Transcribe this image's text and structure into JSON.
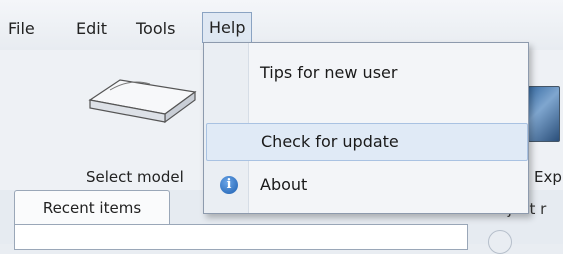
{
  "menubar": {
    "items": [
      {
        "label": "File"
      },
      {
        "label": "Edit"
      },
      {
        "label": "Tools"
      },
      {
        "label": "Help"
      }
    ]
  },
  "toolbar": {
    "select_model_label": "Select model",
    "right_label": "Exp"
  },
  "help_menu": {
    "items": [
      {
        "label": "Tips for new user"
      },
      {
        "label": "Check for update"
      },
      {
        "label": "About",
        "icon": "info-icon"
      }
    ],
    "hovered_item": "Check for update"
  },
  "tabs": {
    "recent_items_label": "Recent items",
    "side_label": "Project r"
  }
}
